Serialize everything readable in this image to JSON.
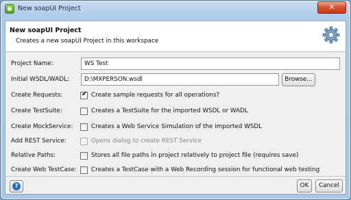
{
  "window": {
    "title": "New soapUI Project",
    "close_glyph": "✕"
  },
  "header": {
    "title": "New soapUI Project",
    "subtitle": "Creates a new soapUI Project in this workspace",
    "icon": "gear-icon"
  },
  "form": {
    "project_name": {
      "label": "Project Name:",
      "value": "WS Test"
    },
    "wsdl": {
      "label": "Initial WSDL/WADL:",
      "value": "D:\\MXPERSON.wsdl",
      "browse_label": "Browse..."
    },
    "options": [
      {
        "label": "Create Requests:",
        "text": "Create sample requests for all operations?",
        "checked": true,
        "enabled": true
      },
      {
        "label": "Create TestSuite:",
        "text": "Creates a TestSuite for the imported WSDL or WADL",
        "checked": false,
        "enabled": true
      },
      {
        "label": "Create MockService:",
        "text": "Creates a Web Service Simulation of the imported WSDL",
        "checked": false,
        "enabled": true
      },
      {
        "label": "Add REST Service:",
        "text": "Opens dialog to create REST Service",
        "checked": false,
        "enabled": false
      },
      {
        "label": "Relative Paths:",
        "text": "Stores all file paths in project relatively to project file (requires save)",
        "checked": false,
        "enabled": true
      },
      {
        "label": "Create Web TestCase:",
        "text": "Creates a TestCase with a Web Recording session for functional web testing",
        "checked": false,
        "enabled": true
      }
    ]
  },
  "footer": {
    "help_glyph": "?",
    "ok_label": "OK",
    "cancel_label": "Cancel"
  }
}
